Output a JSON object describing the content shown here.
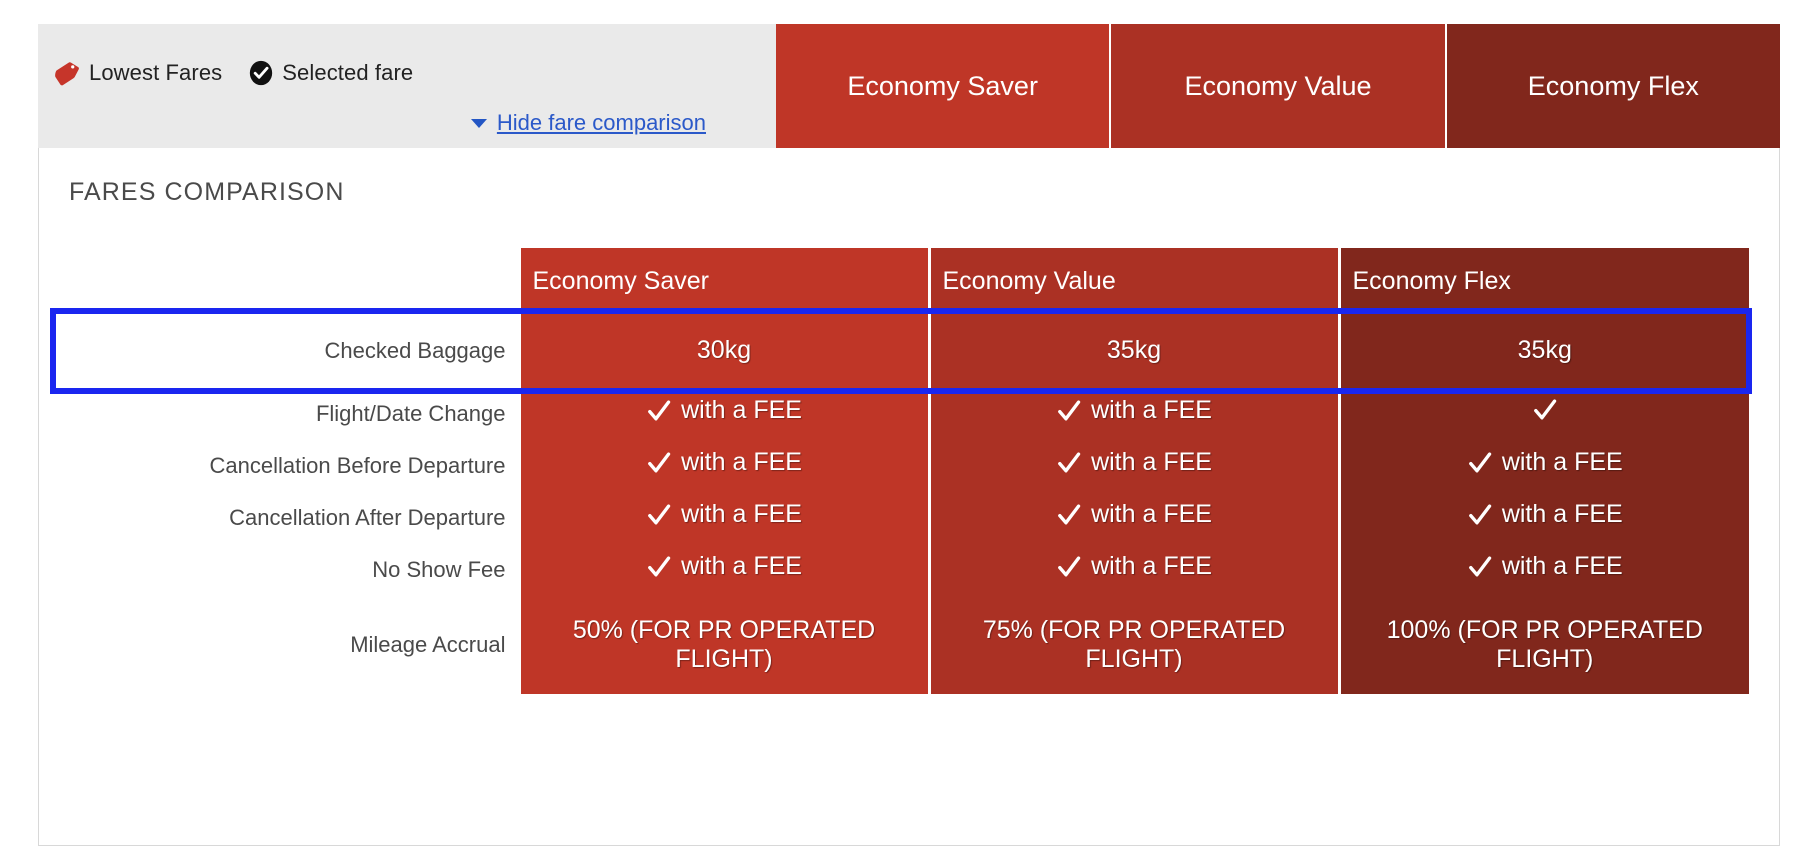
{
  "legend": {
    "lowest_fares_label": "Lowest Fares",
    "selected_fare_label": "Selected fare",
    "hide_link_label": "Hide fare comparison",
    "tag_icon": "price-tag-icon",
    "check_icon": "check-badge-icon",
    "caret_icon": "chevron-down-icon"
  },
  "fare_tabs": [
    {
      "label": "Economy Saver",
      "color": "#bf3627"
    },
    {
      "label": "Economy Value",
      "color": "#ab3124"
    },
    {
      "label": "Economy Flex",
      "color": "#81271c"
    }
  ],
  "panel": {
    "title": "FARES COMPARISON"
  },
  "table": {
    "columns": [
      "Economy Saver",
      "Economy Value",
      "Economy Flex"
    ],
    "rows": [
      {
        "label": "Checked Baggage",
        "highlighted": true,
        "cells": [
          {
            "check": false,
            "text": "30kg"
          },
          {
            "check": false,
            "text": "35kg"
          },
          {
            "check": false,
            "text": "35kg"
          }
        ]
      },
      {
        "label": "Flight/Date Change",
        "highlighted": false,
        "cells": [
          {
            "check": true,
            "text": "with a FEE"
          },
          {
            "check": true,
            "text": "with a FEE"
          },
          {
            "check": true,
            "text": ""
          }
        ]
      },
      {
        "label": "Cancellation Before Departure",
        "highlighted": false,
        "cells": [
          {
            "check": true,
            "text": "with a FEE"
          },
          {
            "check": true,
            "text": "with a FEE"
          },
          {
            "check": true,
            "text": "with a FEE"
          }
        ]
      },
      {
        "label": "Cancellation After Departure",
        "highlighted": false,
        "cells": [
          {
            "check": true,
            "text": "with a FEE"
          },
          {
            "check": true,
            "text": "with a FEE"
          },
          {
            "check": true,
            "text": "with a FEE"
          }
        ]
      },
      {
        "label": "No Show Fee",
        "highlighted": false,
        "cells": [
          {
            "check": true,
            "text": "with a FEE"
          },
          {
            "check": true,
            "text": "with a FEE"
          },
          {
            "check": true,
            "text": "with a FEE"
          }
        ]
      },
      {
        "label": "Mileage Accrual",
        "highlighted": false,
        "cells": [
          {
            "check": false,
            "text": "50% (FOR PR OPERATED FLIGHT)"
          },
          {
            "check": false,
            "text": "75% (FOR PR OPERATED FLIGHT)"
          },
          {
            "check": false,
            "text": "100% (FOR PR OPERATED FLIGHT)"
          }
        ]
      }
    ]
  },
  "colors": {
    "saver_red": "#bf3627",
    "value_red": "#ab3124",
    "flex_red": "#81271c",
    "highlight_blue": "#1a26f0",
    "link_blue": "#2b59c9",
    "legend_bg": "#eaeaea"
  }
}
